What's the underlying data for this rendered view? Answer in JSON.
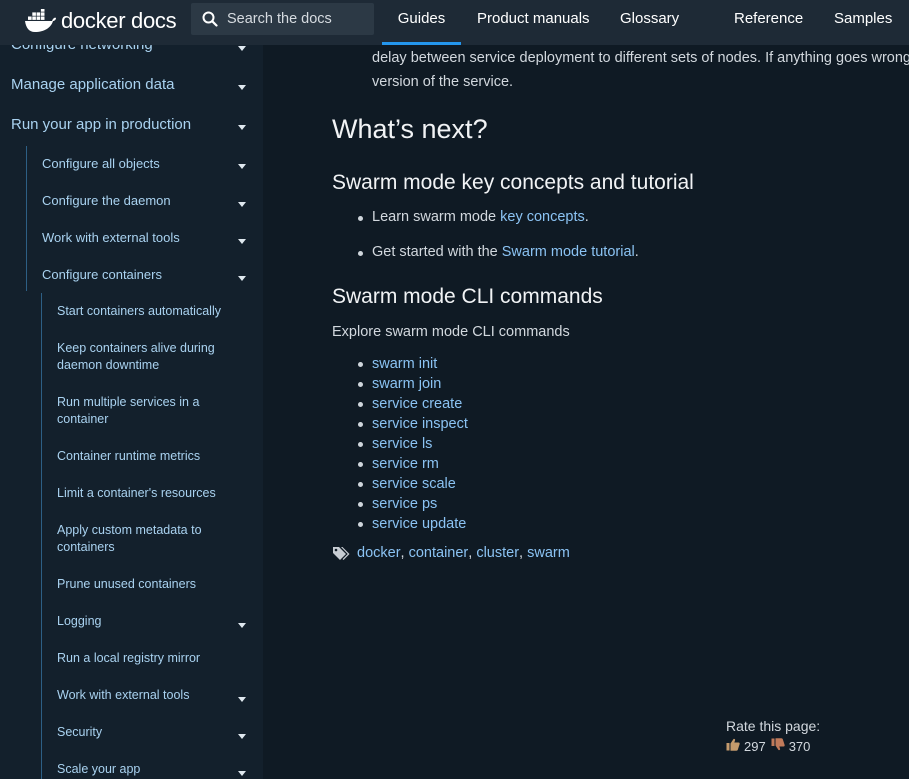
{
  "header": {
    "logo_text": "docker docs",
    "search_placeholder": "Search the docs",
    "nav": [
      "Guides",
      "Product manuals",
      "Glossary",
      "Reference",
      "Samples"
    ],
    "active_nav": "Guides"
  },
  "sidebar": {
    "top_partial": "Configure networking",
    "level1": [
      "Manage application data",
      "Run your app in production"
    ],
    "level2": [
      "Configure all objects",
      "Configure the daemon",
      "Work with external tools",
      "Configure containers"
    ],
    "level3": [
      "Start containers automatically",
      "Keep containers alive during daemon downtime",
      "Run multiple services in a container",
      "Container runtime metrics",
      "Limit a container's resources",
      "Apply custom metadata to containers",
      "Prune unused containers",
      "Logging",
      "Run a local registry mirror",
      "Work with external tools",
      "Security",
      "Scale your app"
    ]
  },
  "main": {
    "intro_line1": "delay between service deployment to different sets of nodes. If anything goes wrong",
    "intro_line2": "version of the service.",
    "whats_next": "What’s next?",
    "concepts_heading": "Swarm mode key concepts and tutorial",
    "concepts_bullets": [
      {
        "text": "Learn swarm mode ",
        "link": "key concepts",
        "suffix": "."
      },
      {
        "text": "Get started with the ",
        "link": "Swarm mode tutorial",
        "suffix": "."
      }
    ],
    "cli_heading": "Swarm mode CLI commands",
    "explore_text": "Explore swarm mode CLI commands",
    "cli_commands": [
      "swarm init",
      "swarm join",
      "service create",
      "service inspect",
      "service ls",
      "service rm",
      "service scale",
      "service ps",
      "service update"
    ],
    "tags": [
      "docker",
      "container",
      "cluster",
      "swarm"
    ],
    "rate_label": "Rate this page:",
    "thumbs_up": "297",
    "thumbs_down": "370"
  },
  "colors": {
    "accent": "#2496ed",
    "link": "#8bc3f3",
    "sidebar_bg": "#13202c",
    "main_bg": "#0f1a24",
    "topbar_bg": "#1e2a36"
  }
}
